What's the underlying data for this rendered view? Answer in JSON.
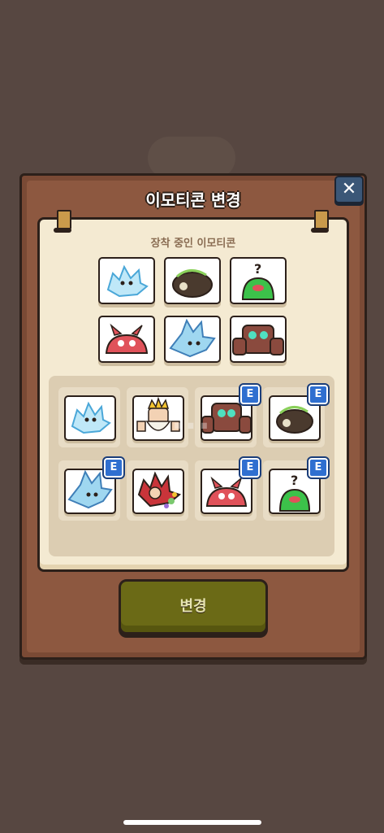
{
  "dialog": {
    "title": "이모티콘 변경",
    "close_label": "✕"
  },
  "equipped": {
    "label": "장착 중인 이모티콘",
    "items": [
      {
        "name": "ice-spirit",
        "color": "#bfe8f8"
      },
      {
        "name": "dark-boar",
        "color": "#4a3a2e"
      },
      {
        "name": "green-slime-question",
        "color": "#3cc24a"
      },
      {
        "name": "red-horned-creature",
        "color": "#e0525a"
      },
      {
        "name": "ice-crystal-creature",
        "color": "#9fd7f0"
      },
      {
        "name": "stone-golem",
        "color": "#8a4a3e"
      }
    ]
  },
  "inventory": {
    "badge_label": "E",
    "watermark": "...",
    "items": [
      {
        "name": "ice-spirit",
        "equipped": false
      },
      {
        "name": "bearded-king",
        "equipped": false
      },
      {
        "name": "stone-golem",
        "equipped": true
      },
      {
        "name": "dark-boar",
        "equipped": true
      },
      {
        "name": "ice-crystal-creature",
        "equipped": true
      },
      {
        "name": "red-spiky-jester",
        "equipped": false
      },
      {
        "name": "red-horned-creature",
        "equipped": true
      },
      {
        "name": "green-slime-question",
        "equipped": true
      }
    ]
  },
  "actions": {
    "change_label": "변경"
  },
  "colors": {
    "panel": "#8d5840",
    "parchment": "#f4ead2",
    "button": "#6b6a16",
    "badge": "#2f6fd0"
  }
}
